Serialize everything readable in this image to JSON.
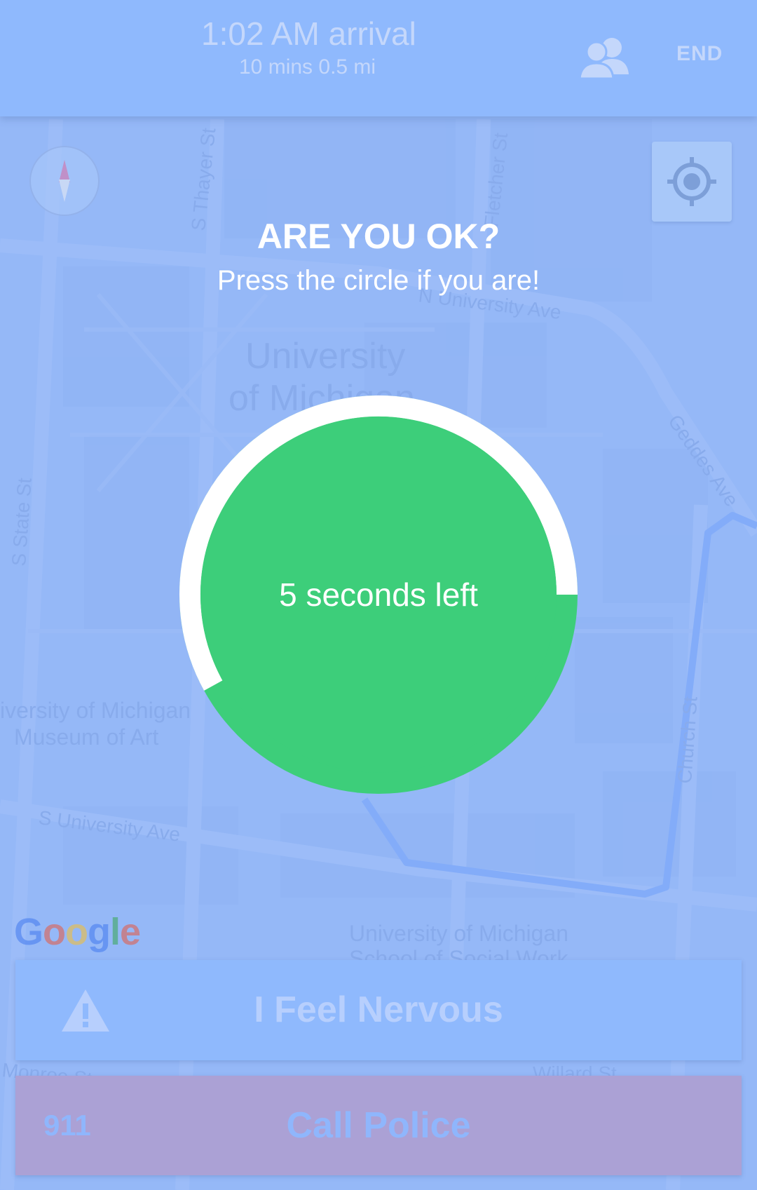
{
  "header": {
    "arrival": "1:02 AM arrival",
    "eta": "10 mins 0.5 mi",
    "end_label": "END"
  },
  "map": {
    "streets": [
      "S Thayer St",
      "Fletcher St",
      "N University Ave",
      "Geddes Ave",
      "S State St",
      "Church St",
      "S University Ave",
      "Monroe St"
    ],
    "places": [
      "University",
      "of Michigan",
      "iversity of Michigan",
      "Museum of Art",
      "University of Michigan",
      "School of Social Work",
      "Willard St"
    ],
    "attribution": "Google"
  },
  "prompt": {
    "title": "ARE YOU OK?",
    "subtitle": "Press the circle if you are!"
  },
  "timer": {
    "text": "5 seconds left",
    "progress_remaining": 0.58,
    "colors": {
      "circle": "#3dce7a",
      "ring": "#ffffff"
    }
  },
  "actions": {
    "nervous_label": "I Feel Nervous",
    "police_number": "911",
    "police_label": "Call Police"
  },
  "colors": {
    "header": "#8fb9fd",
    "nervous_button": "#8fb9fd",
    "police_button": "#aba1d5",
    "route": "#7fa8f8"
  }
}
